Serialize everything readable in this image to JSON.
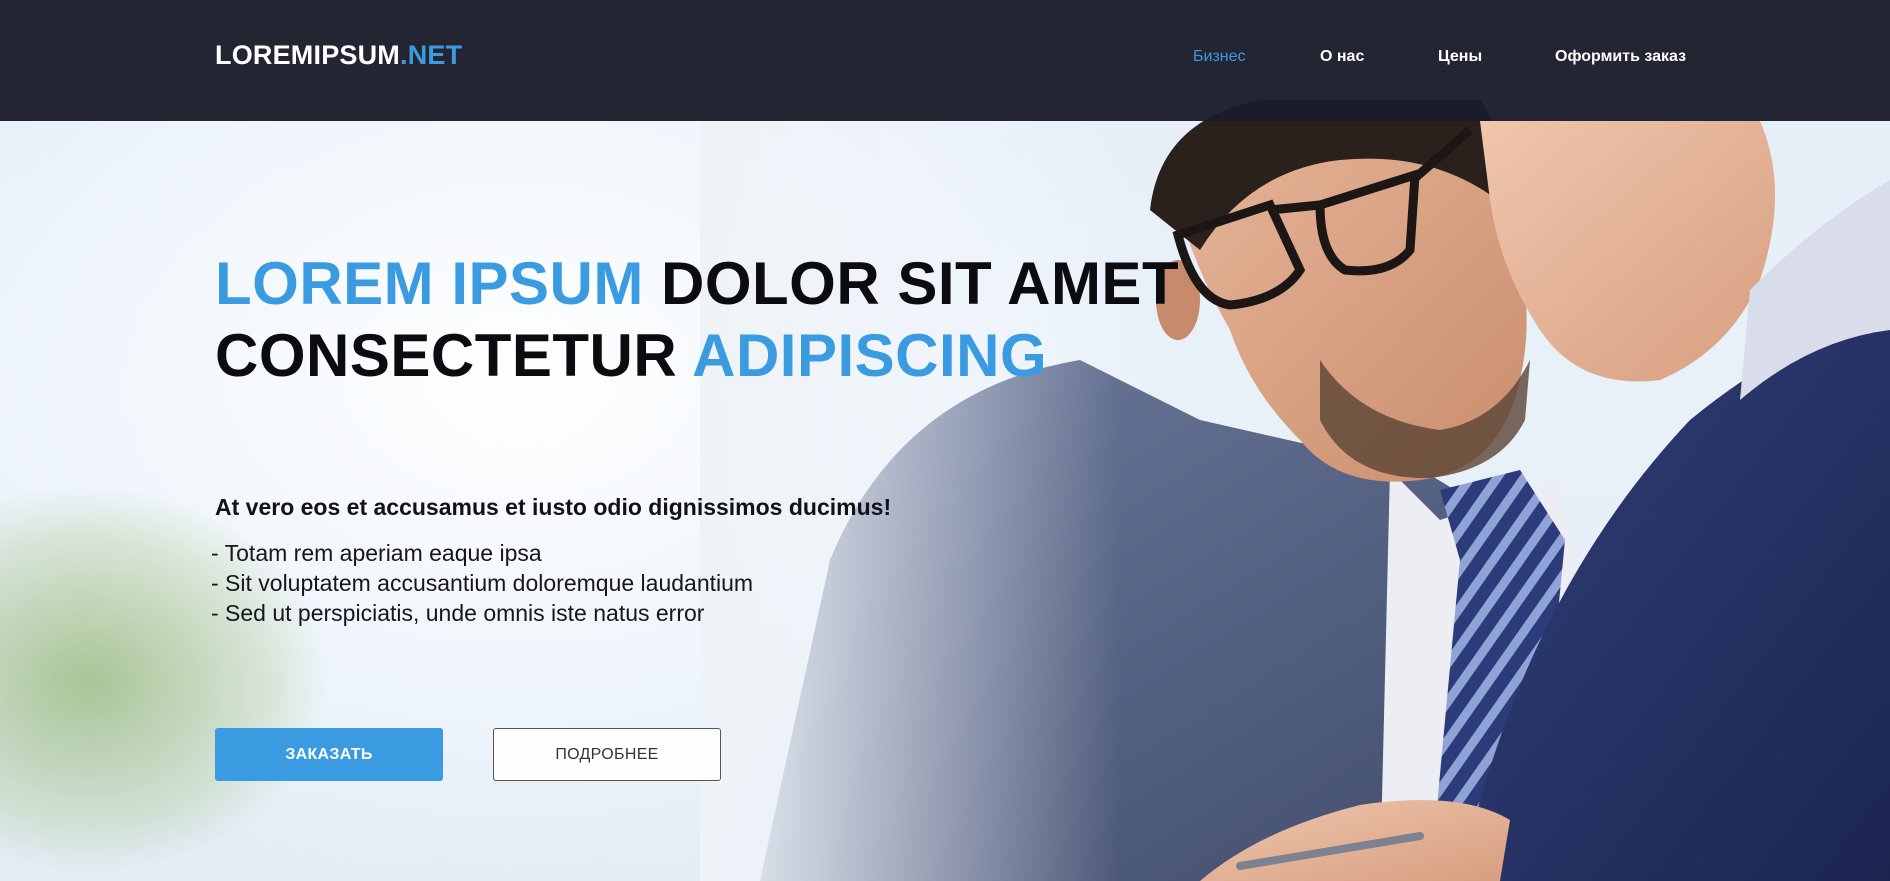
{
  "header": {
    "logo": {
      "main": "LOREMIPSUM",
      "accent": ".NET"
    },
    "nav": [
      {
        "label": "Бизнес",
        "active": true
      },
      {
        "label": "О нас",
        "active": false
      },
      {
        "label": "Цены",
        "active": false
      },
      {
        "label": "Оформить заказ",
        "active": false
      }
    ]
  },
  "hero": {
    "headline": {
      "line1_blue": "LOREM IPSUM",
      "line1_dark": " DOLOR SIT AMET",
      "line2_dark": "CONSECTETUR ",
      "line2_blue": "ADIPISCING"
    },
    "tagline": "At vero eos et accusamus et iusto odio dignissimos ducimus!",
    "bullets": [
      "- Totam rem aperiam eaque ipsa",
      "- Sit voluptatem accusantium doloremque laudantium",
      "- Sed ut perspiciatis, unde omnis iste natus error"
    ],
    "buttons": {
      "primary": "ЗАКАЗАТЬ",
      "secondary": "ПОДРОБНЕЕ"
    },
    "photo_subject": "businessmen-photo"
  },
  "colors": {
    "accent": "#3a9be0",
    "header_bg": "#1b1c2a",
    "text_dark": "#0b0b10",
    "suit_blue": "#4a5a80"
  }
}
